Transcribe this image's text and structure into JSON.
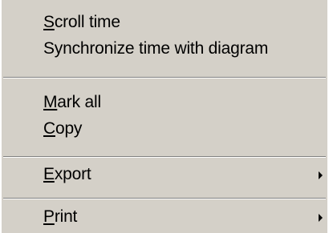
{
  "menu": {
    "items": [
      {
        "label": "Scroll time",
        "accel": "S",
        "rest": "croll time"
      },
      {
        "label": "Synchronize time with diagram"
      },
      {
        "label": "Mark all",
        "accel": "M",
        "rest": "ark all"
      },
      {
        "label": "Copy",
        "accel": "C",
        "rest": "opy"
      },
      {
        "label": "Export",
        "accel": "E",
        "rest": "xport",
        "submenu": true
      },
      {
        "label": "Print",
        "accel": "P",
        "rest": "rint",
        "submenu": true
      }
    ]
  },
  "colors": {
    "menu_background": "#d4d0c8",
    "separator_dark": "#808080",
    "separator_light": "#ffffff",
    "text": "#000000"
  },
  "icons": {
    "submenu_arrow": "triangle-right-icon"
  }
}
